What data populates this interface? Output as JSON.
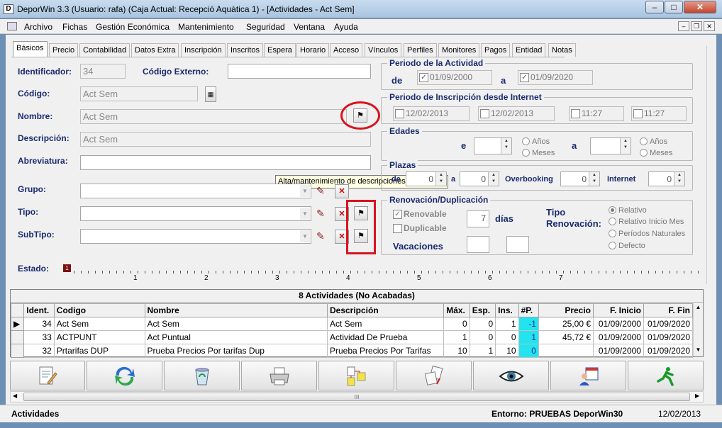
{
  "window": {
    "title": "DeporWin 3.3  (Usuario: rafa)  (Caja Actual: Recepció Aquàtica 1) - [Actividades - Act Sem]",
    "app_letter": "D"
  },
  "menu": [
    "Archivo",
    "Fichas",
    "Gestión Económica",
    "Mantenimiento",
    "Seguridad",
    "Ventana",
    "Ayuda"
  ],
  "tabs": [
    "Básicos",
    "Precio",
    "Contabilidad",
    "Datos Extra",
    "Inscripción",
    "Inscritos",
    "Espera",
    "Horario",
    "Acceso",
    "Vínculos",
    "Perfiles",
    "Monitores",
    "Pagos",
    "Entidad",
    "Notas"
  ],
  "form": {
    "identificador_label": "Identificador:",
    "identificador": "34",
    "codigo_externo_label": "Código Externo:",
    "codigo_externo": "",
    "codigo_label": "Código:",
    "codigo": "Act Sem",
    "nombre_label": "Nombre:",
    "nombre": "Act Sem",
    "descripcion_label": "Descripción:",
    "descripcion": "Act Sem",
    "abreviatura_label": "Abreviatura:",
    "abreviatura": "",
    "grupo_label": "Grupo:",
    "tipo_label": "Tipo:",
    "subtipo_label": "SubTipo:",
    "estado_label": "Estado:",
    "estado_value": "1"
  },
  "tooltip": "Alta/mantenimiento de descripciones multidioma",
  "periodo": {
    "title": "Periodo de la Actividad",
    "de": "de",
    "a": "a",
    "from": "01/09/2000",
    "to": "01/09/2020"
  },
  "inscripcion": {
    "title": "Periodo de Inscripción desde Internet",
    "date1": "12/02/2013",
    "date2": "12/02/2013",
    "time1": "11:27",
    "time2": "11:27"
  },
  "edades": {
    "title": "Edades",
    "e": "e",
    "a": "a",
    "anos": "Años",
    "meses": "Meses"
  },
  "plazas": {
    "title": "Plazas",
    "de": "de",
    "de_val": "0",
    "a": "a",
    "a_val": "0",
    "overbooking": "Overbooking",
    "overbooking_val": "0",
    "internet": "Internet",
    "internet_val": "0"
  },
  "renovacion": {
    "title": "Renovación/Duplicación",
    "renovable": "Renovable",
    "duplicable": "Duplicable",
    "dias_val": "7",
    "dias": "días",
    "vacaciones": "Vacaciones",
    "tipo_label": "Tipo Renovación:",
    "options": [
      "Relativo",
      "Relativo Inicio Mes",
      "Períodos Naturales",
      "Defecto"
    ]
  },
  "ruler_numbers": [
    "1",
    "2",
    "3",
    "4",
    "5",
    "6",
    "7"
  ],
  "grid": {
    "caption": "8 Actividades  (No Acabadas)",
    "columns": [
      "Ident.",
      "Codigo",
      "Nombre",
      "Descripción",
      "Máx.",
      "Esp.",
      "Ins.",
      "#P.",
      "Precio",
      "F. Inicio",
      "F. Fin"
    ],
    "rows": [
      [
        "34",
        "Act Sem",
        "Act Sem",
        "Act Sem",
        "0",
        "0",
        "1",
        "-1",
        "25,00 €",
        "01/09/2000",
        "01/09/2020"
      ],
      [
        "33",
        "ACTPUNT",
        "Act Puntual",
        "Actividad De Prueba",
        "1",
        "0",
        "0",
        "1",
        "45,72 €",
        "01/09/2000",
        "01/09/2020"
      ],
      [
        "32",
        "Prtarifas DUP",
        "Prueba Precios Por  tarifas Dup",
        "Prueba Precios Por Tarifas",
        "10",
        "1",
        "10",
        "0",
        "",
        "01/09/2000",
        "01/09/2020"
      ]
    ]
  },
  "scroll_mark": "III",
  "status": {
    "left": "Actividades",
    "entorno": "Entorno: PRUEBAS DeporWin30",
    "date": "12/02/2013"
  },
  "colors": {
    "label": "#1a2b6e",
    "cyan_cell": "#23e3ee",
    "annotation": "#d9131f"
  }
}
